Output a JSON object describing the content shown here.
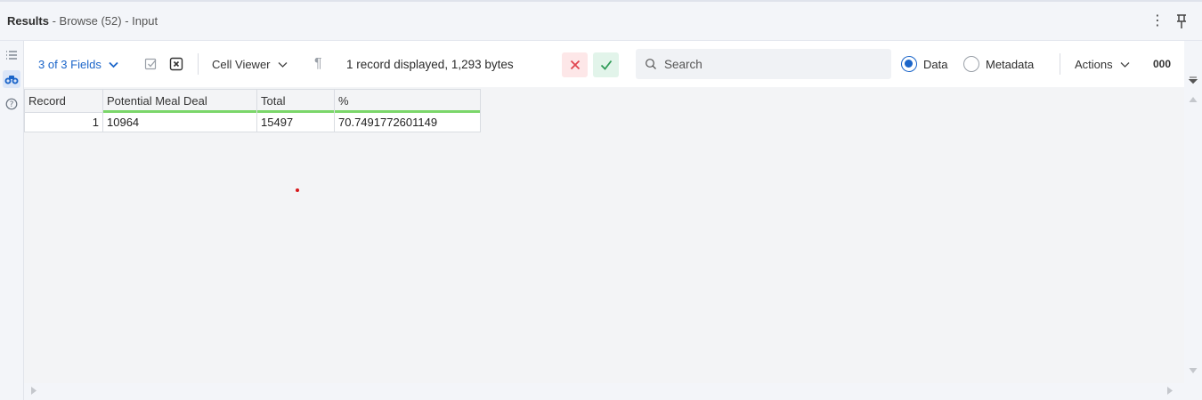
{
  "window": {
    "title_strong": "Results",
    "title_rest": " - Browse (52) - Input"
  },
  "toolbar": {
    "fields_label": "3 of 3 Fields",
    "cell_viewer_label": "Cell Viewer",
    "pilcrow": "¶",
    "record_info": "1 record displayed, 1,293 bytes",
    "search_placeholder": "Search",
    "data_label": "Data",
    "metadata_label": "Metadata",
    "view_selected": "Data",
    "actions_label": "Actions",
    "overflow_label": "000"
  },
  "grid": {
    "columns": [
      "Record",
      "Potential Meal Deal",
      "Total",
      "%"
    ],
    "rows": [
      [
        "1",
        "10964",
        "15497",
        "70.7491772601149"
      ]
    ]
  },
  "colors": {
    "accent": "#1b65c9",
    "cancel_bg": "#fde7e8",
    "cancel_fg": "#e0454f",
    "apply_bg": "#e2f4ea",
    "apply_fg": "#2f9b57",
    "header_underline": "#7bd66a",
    "marker": "#d7191c"
  },
  "icons": {
    "rail": [
      "list-icon",
      "binoculars-icon",
      "help-icon"
    ],
    "title_bar": [
      "kebab-icon",
      "pin-icon"
    ]
  }
}
